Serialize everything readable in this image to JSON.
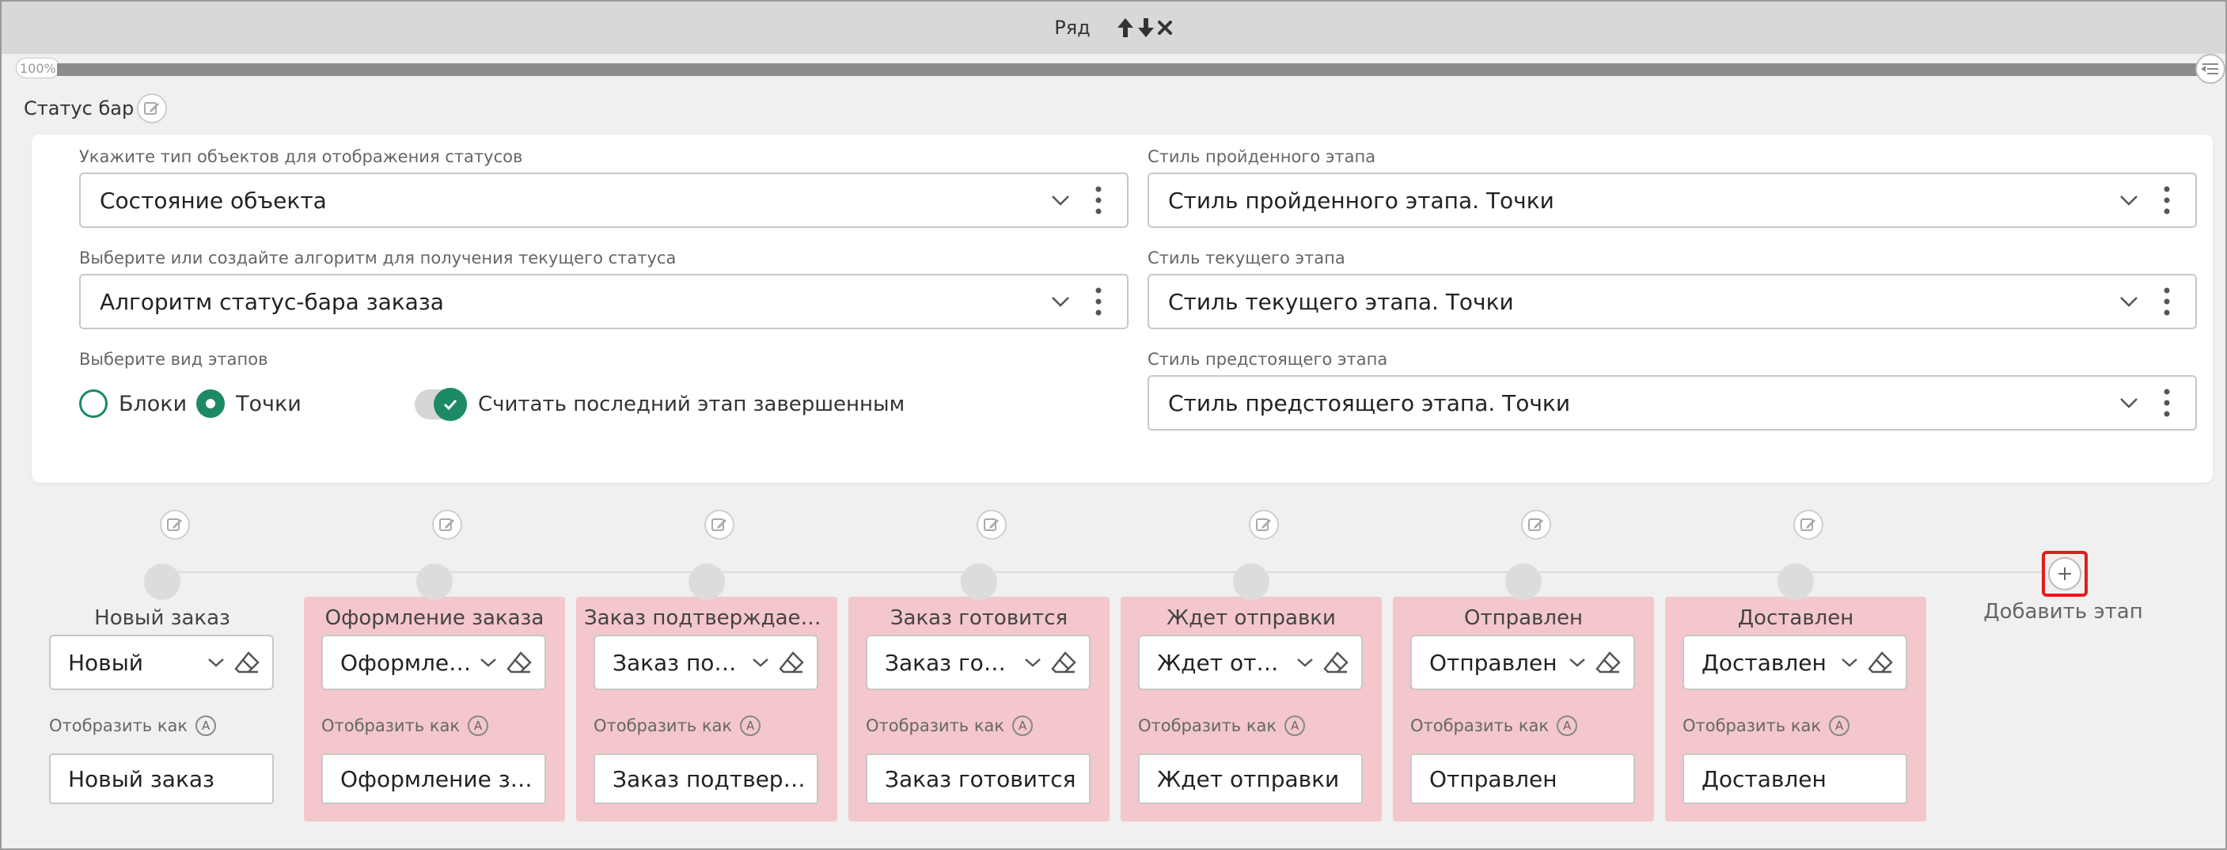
{
  "header": {
    "title": "Ряд"
  },
  "zoom": {
    "label": "100%"
  },
  "section": {
    "title": "Статус бар"
  },
  "settings": {
    "object_type": {
      "label": "Укажите тип объектов для отображения статусов",
      "value": "Состояние объекта"
    },
    "algorithm": {
      "label": "Выберите или создайте алгоритм для получения текущего статуса",
      "value": "Алгоритм статус-бара заказа"
    },
    "stage_view": {
      "label": "Выберите вид этапов",
      "options": [
        {
          "label": "Блоки",
          "checked": false
        },
        {
          "label": "Точки",
          "checked": true
        }
      ]
    },
    "last_stage_complete": {
      "label": "Считать последний этап завершенным",
      "checked": true
    },
    "passed_style": {
      "label": "Стиль пройденного этапа",
      "value": "Стиль пройденного этапа. Точки"
    },
    "current_style": {
      "label": "Стиль текущего этапа",
      "value": "Стиль текущего этапа. Точки"
    },
    "upcoming_style": {
      "label": "Стиль предстоящего этапа",
      "value": "Стиль предстоящего этапа. Точки"
    }
  },
  "stages": {
    "display_as_label": "Отобразить как",
    "items": [
      {
        "title": "Новый заказ",
        "select": "Новый",
        "display": "Новый заказ"
      },
      {
        "title": "Оформление заказа",
        "select": "Оформление заказа",
        "display": "Оформление заказа"
      },
      {
        "title": "Заказ подтверждается",
        "select": "Заказ подтверждается",
        "display": "Заказ подтверждается"
      },
      {
        "title": "Заказ готовится",
        "select": "Заказ готовится",
        "display": "Заказ готовится"
      },
      {
        "title": "Ждет отправки",
        "select": "Ждет отправки",
        "display": "Ждет отправки"
      },
      {
        "title": "Отправлен",
        "select": "Отправлен",
        "display": "Отправлен"
      },
      {
        "title": "Доставлен",
        "select": "Доставлен",
        "display": "Доставлен"
      }
    ],
    "add_label": "Добавить этап"
  },
  "colors": {
    "accent": "#1d8a67",
    "stage_pink": "#f3c7cb",
    "highlight": "#e01d1d"
  }
}
